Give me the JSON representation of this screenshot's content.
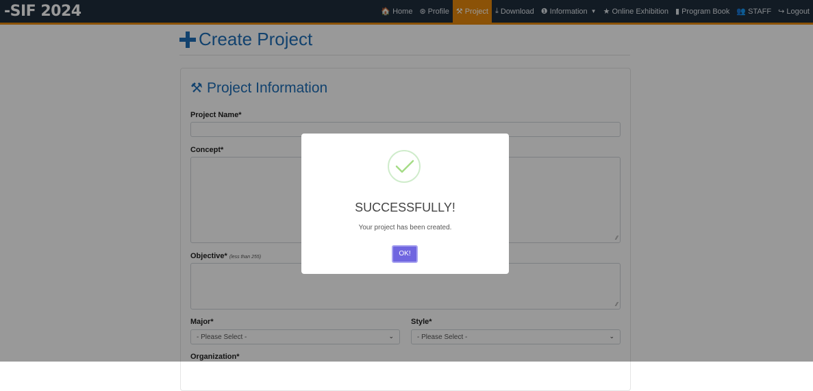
{
  "brand": "-SIF 2024",
  "nav": [
    {
      "icon": "🏠",
      "label": "Home",
      "icon_name": "home-icon"
    },
    {
      "icon": "⊛",
      "label": "Profile",
      "icon_name": "profile-icon"
    },
    {
      "icon": "⚒",
      "label": "Project",
      "icon_name": "compass-drafting-icon",
      "active": true
    },
    {
      "icon": "⤓",
      "label": "Download",
      "icon_name": "download-icon"
    },
    {
      "icon": "❶",
      "label": "Information",
      "icon_name": "info-icon",
      "dropdown": true
    },
    {
      "icon": "★",
      "label": "Online Exhibition",
      "icon_name": "star-icon"
    },
    {
      "icon": "▮",
      "label": "Program Book",
      "icon_name": "book-icon"
    },
    {
      "icon": "👥",
      "label": "STAFF",
      "icon_name": "users-icon"
    },
    {
      "icon": "↪",
      "label": "Logout",
      "icon_name": "logout-icon"
    }
  ],
  "page": {
    "title": "Create Project",
    "section_title": "Project Information"
  },
  "form": {
    "project_name_label": "Project Name*",
    "concept_label": "Concept*",
    "objective_label": "Objective*",
    "objective_hint": "(less than 255)",
    "major_label": "Major*",
    "major_value": "- Please Select -",
    "style_label": "Style*",
    "style_value": "- Please Select -",
    "organization_label": "Organization*"
  },
  "modal": {
    "title": "SUCCESSFULLY!",
    "message": "Your project has been created.",
    "ok_label": "OK!"
  },
  "colors": {
    "navbar": "#1f2d3d",
    "accent": "#e8890c",
    "primary": "#1f6fb8",
    "ok_button": "#7066e0",
    "success": "#a5dc86"
  }
}
